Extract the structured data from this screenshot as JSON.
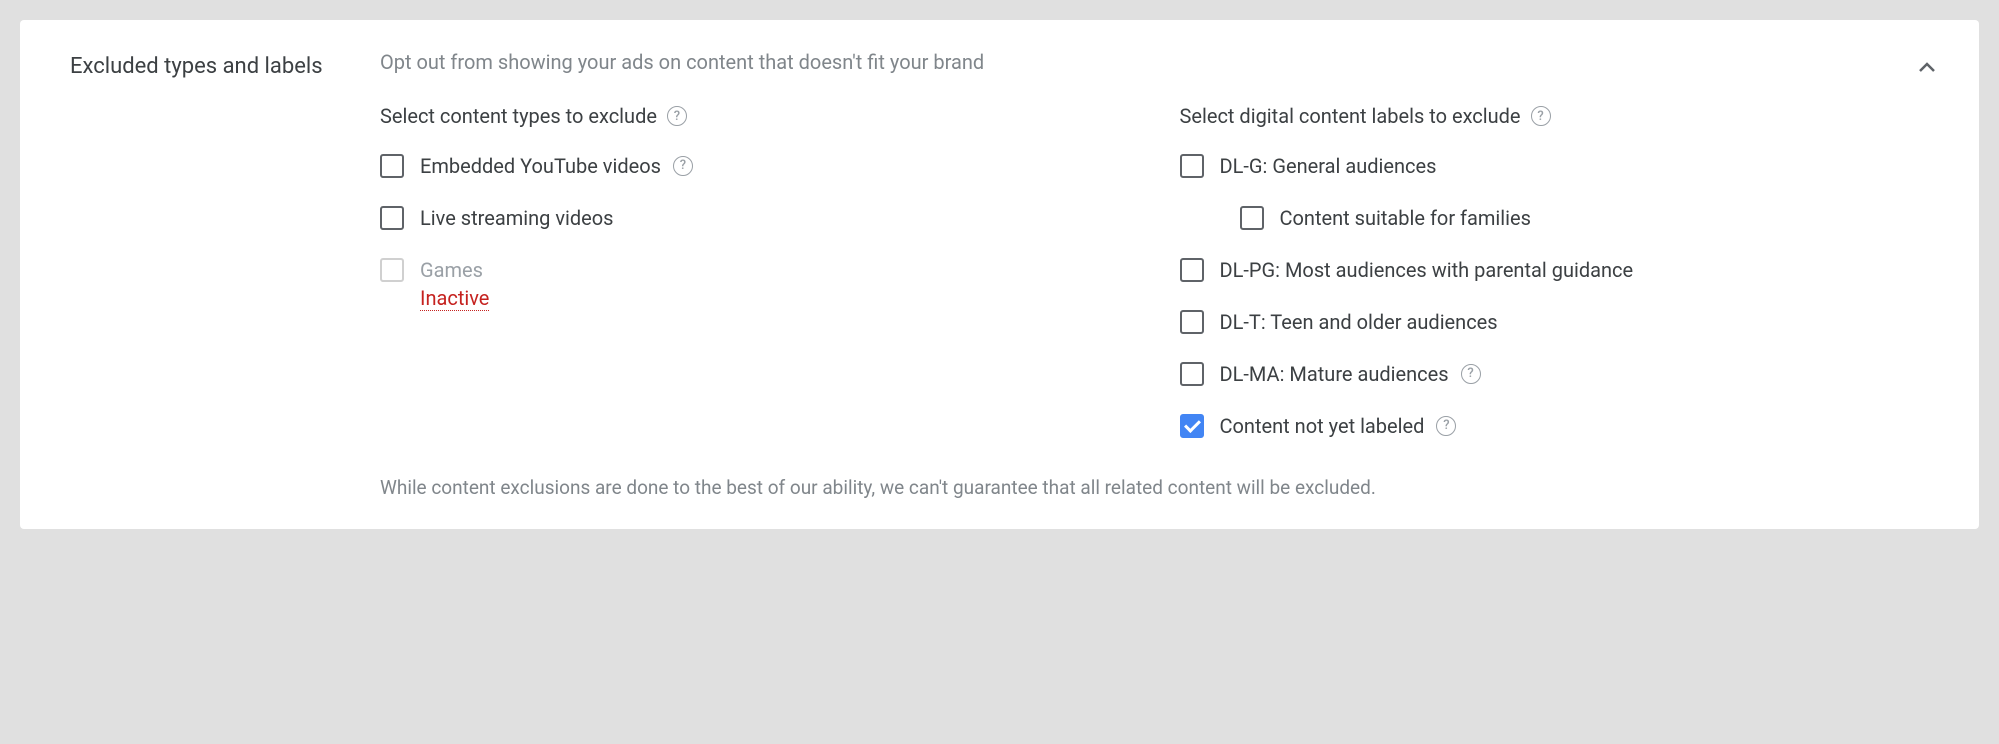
{
  "panel": {
    "title": "Excluded types and labels",
    "description": "Opt out from showing your ads on content that doesn't fit your brand",
    "footnote": "While content exclusions are done to the best of our ability, we can't guarantee that all related content will be excluded."
  },
  "content_types": {
    "title": "Select content types to exclude",
    "items": {
      "embedded": {
        "label": "Embedded YouTube videos",
        "checked": false,
        "has_help": true
      },
      "live": {
        "label": "Live streaming videos",
        "checked": false,
        "has_help": false
      },
      "games": {
        "label": "Games",
        "status": "Inactive",
        "disabled": true
      }
    }
  },
  "digital_labels": {
    "title": "Select digital content labels to exclude",
    "items": {
      "dl_g": {
        "label": "DL-G: General audiences",
        "checked": false,
        "has_help": false
      },
      "families": {
        "label": "Content suitable for families",
        "checked": false,
        "has_help": false,
        "nested": true
      },
      "dl_pg": {
        "label": "DL-PG: Most audiences with parental guidance",
        "checked": false,
        "has_help": false
      },
      "dl_t": {
        "label": "DL-T: Teen and older audiences",
        "checked": false,
        "has_help": false
      },
      "dl_ma": {
        "label": "DL-MA: Mature audiences",
        "checked": false,
        "has_help": true
      },
      "not_labeled": {
        "label": "Content not yet labeled",
        "checked": true,
        "has_help": true
      }
    }
  },
  "help_glyph": "?"
}
